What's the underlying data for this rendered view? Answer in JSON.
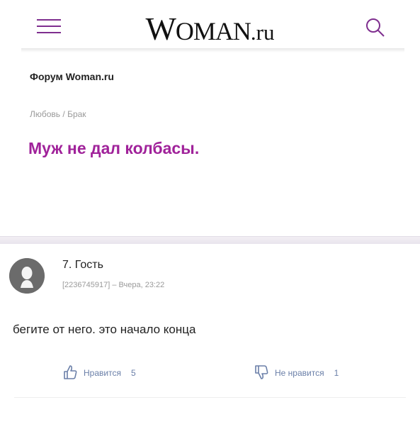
{
  "header": {
    "logo_w": "W",
    "logo_oman": "OMAN",
    "logo_ru": ".ru",
    "menu_icon": "hamburger-icon",
    "search_icon": "search-icon",
    "accent_color": "#a0229a"
  },
  "forum": {
    "title": "Форум Woman.ru"
  },
  "breadcrumb": {
    "item_1": "Любовь",
    "separator": " / ",
    "item_2": "Брак"
  },
  "topic": {
    "title": "Муж не дал колбасы."
  },
  "comment": {
    "author": "7. Гость",
    "id": "[2236745917]",
    "dash": " – ",
    "time": "Вчера, 23:22",
    "text": "бегите от него. это начало конца",
    "like_label": "Нравится",
    "like_count": "5",
    "dislike_label": "Не нравится",
    "dislike_count": "1"
  }
}
